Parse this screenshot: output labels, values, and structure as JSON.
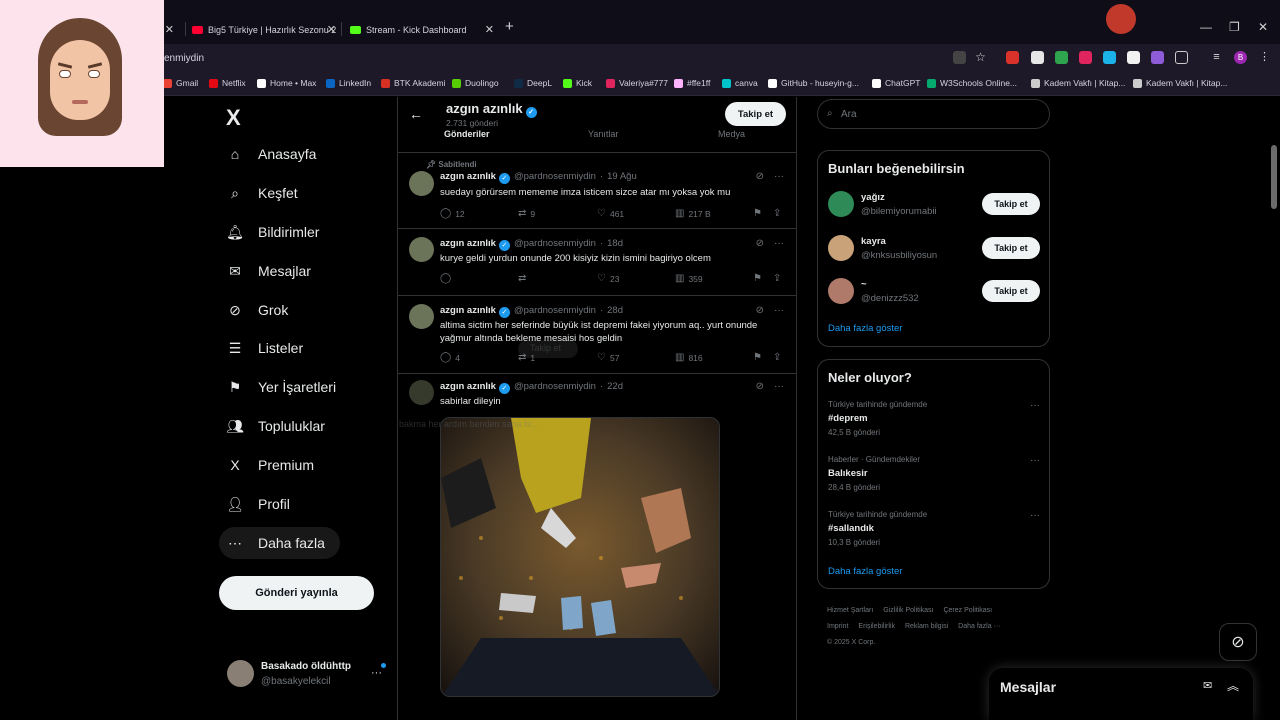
{
  "browser": {
    "tabs": [
      {
        "title": "Big5 Türkiye | Hazırlık Sezonu 2",
        "color": "#ff0033"
      },
      {
        "title": "Stream - Kick Dashboard",
        "color": "#53fc18"
      }
    ],
    "new_tab": "+",
    "url": "enmiydin",
    "bookmarks": [
      {
        "label": "Gmail",
        "color": "#ea4335"
      },
      {
        "label": "Netflix",
        "color": "#e50914"
      },
      {
        "label": "Home • Max",
        "color": "#ffffff"
      },
      {
        "label": "LinkedIn",
        "color": "#0a66c2"
      },
      {
        "label": "BTK Akademi",
        "color": "#d93025"
      },
      {
        "label": "Duolingo",
        "color": "#58cc02"
      },
      {
        "label": "DeepL",
        "color": "#0f2b46"
      },
      {
        "label": "Kick",
        "color": "#53fc18"
      },
      {
        "label": "Valeriya#777",
        "color": "#e0245e"
      },
      {
        "label": "#ffe1ff",
        "color": "#ffb3ff"
      },
      {
        "label": "canva",
        "color": "#00c4cc"
      },
      {
        "label": "GitHub - huseyin-g...",
        "color": "#ffffff"
      },
      {
        "label": "ChatGPT",
        "color": "#ffffff"
      },
      {
        "label": "W3Schools Online...",
        "color": "#04aa6d"
      },
      {
        "label": "Kadem Vakfı | Kitap...",
        "color": "#cccccc"
      },
      {
        "label": "Kadem Vakfı | Kitap...",
        "color": "#cccccc"
      }
    ],
    "profile_initial": "B"
  },
  "nav": {
    "logo": "X",
    "items": [
      {
        "label": "Anasayfa",
        "icon": "home-icon",
        "glyph": "⌂"
      },
      {
        "label": "Keşfet",
        "icon": "search-icon",
        "glyph": "⌕"
      },
      {
        "label": "Bildirimler",
        "icon": "bell-icon",
        "glyph": "🔔︎"
      },
      {
        "label": "Mesajlar",
        "icon": "mail-icon",
        "glyph": "✉"
      },
      {
        "label": "Grok",
        "icon": "grok-icon",
        "glyph": "⊘"
      },
      {
        "label": "Listeler",
        "icon": "list-icon",
        "glyph": "☰"
      },
      {
        "label": "Yer İşaretleri",
        "icon": "bookmark-icon",
        "glyph": "⚑"
      },
      {
        "label": "Topluluklar",
        "icon": "communities-icon",
        "glyph": "👥︎"
      },
      {
        "label": "Premium",
        "icon": "x-premium-icon",
        "glyph": "X"
      },
      {
        "label": "Profil",
        "icon": "profile-icon",
        "glyph": "👤︎"
      },
      {
        "label": "Daha fazla",
        "icon": "more-icon",
        "glyph": "⋯"
      }
    ],
    "post_button": "Gönderi yayınla",
    "account": {
      "name": "Basakado öldühttp",
      "handle": "@basakyelekcil",
      "more": "···"
    }
  },
  "profile_header": {
    "name": "azgın azınlık",
    "posts_count": "2.731 gönderi",
    "tabs": [
      "Gönderiler",
      "Yanıtlar",
      "Medya"
    ],
    "follow": "Takip et"
  },
  "tweets": [
    {
      "pinned": "Sabitlendi",
      "name": "azgın azınlık",
      "handle": "@pardnosenmiydin",
      "time": "19 Ağu",
      "text": "suedayı görürsem mememe imza isticem sizce atar mı yoksa yok mu",
      "replies": "12",
      "reposts": "9",
      "likes": "461",
      "views": "217 B"
    },
    {
      "name": "azgın azınlık",
      "handle": "@pardnosenmiydin",
      "time": "18d",
      "text": "kurye geldi yurdun onunde 200 kisiyiz kizin ismini bagiriyo olcem",
      "replies": "",
      "reposts": "",
      "likes": "23",
      "views": "359"
    },
    {
      "name": "azgın azınlık",
      "handle": "@pardnosenmiydin",
      "time": "28d",
      "text": "altima sictim her seferinde büyük ist depremi fakei yiyorum aq.. yurt onunde yağmur altında bekleme mesaisi hos geldin",
      "replies": "4",
      "reposts": "1",
      "likes": "57",
      "views": "816"
    },
    {
      "name": "azgın azınlık",
      "handle": "@pardnosenmiydin",
      "time": "22d",
      "text": "sabirlar dileyin"
    }
  ],
  "ghost_card": {
    "follow": "Takip et",
    "bio": "bakma her ardım benden sana bi..."
  },
  "sidebar": {
    "search_placeholder": "Ara",
    "suggestions_title": "Bunları beğenebilirsin",
    "suggestions": [
      {
        "name": "yağız",
        "handle": "@bilemiyorumabii",
        "follow": "Takip et",
        "avatar_color": "#2e8b57"
      },
      {
        "name": "kayra",
        "handle": "@knksusbiliyosun",
        "follow": "Takip et",
        "avatar_color": "#c9a27a"
      },
      {
        "name": "~",
        "handle": "@denizzz532",
        "follow": "Takip et",
        "avatar_color": "#b07a6a"
      }
    ],
    "show_more": "Daha fazla göster",
    "trends_title": "Neler oluyor?",
    "trends": [
      {
        "context": "Türkiye tarihinde gündemde",
        "title": "#deprem",
        "posts": "42,5 B gönderi"
      },
      {
        "context": "Haberler · Gündemdekiler",
        "title": "Balıkesir",
        "posts": "28,4 B gönderi"
      },
      {
        "context": "Türkiye tarihinde gündemde",
        "title": "#sallandık",
        "posts": "10,3 B gönderi"
      }
    ],
    "trends_more": "Daha fazla göster",
    "footer": [
      "Hizmet Şartları",
      "Gizlilik Politikası",
      "Çerez Politikası",
      "Imprint",
      "Erişilebilirlik",
      "Reklam bilgisi",
      "Daha fazla ···",
      "© 2025 X Corp."
    ]
  },
  "messages_drawer": {
    "title": "Mesajlar"
  },
  "colors": {
    "accent": "#1d9bf0",
    "background": "#000000",
    "text": "#e7e9ea",
    "muted": "#71767b",
    "border": "#2f3336"
  }
}
